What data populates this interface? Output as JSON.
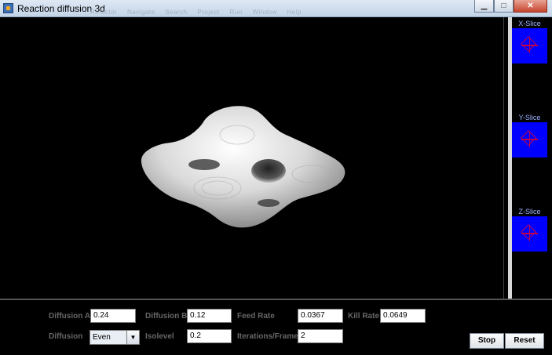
{
  "window": {
    "title": "Reaction diffusion 3d",
    "faint_menu": [
      "Refactor",
      "Navigate",
      "Search",
      "Project",
      "Run",
      "Window",
      "Help"
    ],
    "controls": {
      "minimize": "▁",
      "maximize": "□",
      "close": "✕"
    }
  },
  "slices": [
    {
      "label": "X-Slice"
    },
    {
      "label": "Y-Slice"
    },
    {
      "label": "Z-Slice"
    }
  ],
  "params": {
    "diffusion_a": {
      "label": "Diffusion A",
      "value": "0.24"
    },
    "diffusion_b": {
      "label": "Diffusion B",
      "value": "0.12"
    },
    "feed_rate": {
      "label": "Feed Rate",
      "value": "0.0367"
    },
    "kill_rate": {
      "label": "Kill Rate",
      "value": "0.0649"
    },
    "diffusion": {
      "label": "Diffusion",
      "value": "Even"
    },
    "isolevel": {
      "label": "Isolevel",
      "value": "0.2"
    },
    "iterations": {
      "label": "Iterations/Frame",
      "value": "2"
    }
  },
  "buttons": {
    "stop": "Stop",
    "reset": "Reset"
  },
  "colors": {
    "slice_bg": "#0000ff",
    "slice_marker": "#c0004a",
    "viewport_bg": "#000000"
  }
}
